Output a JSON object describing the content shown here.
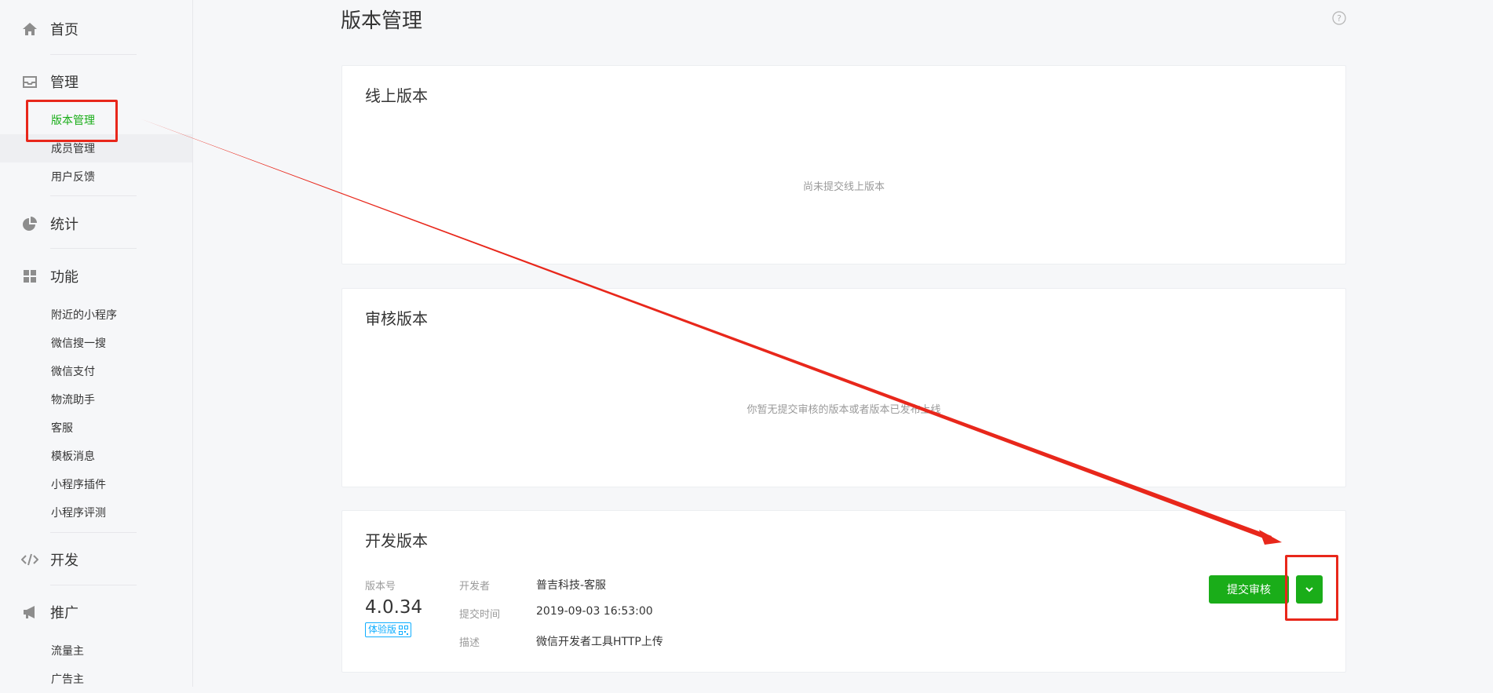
{
  "sidebar": {
    "home": "首页",
    "manage": {
      "title": "管理",
      "items": [
        "版本管理",
        "成员管理",
        "用户反馈"
      ]
    },
    "stats": "统计",
    "features": {
      "title": "功能",
      "items": [
        "附近的小程序",
        "微信搜一搜",
        "微信支付",
        "物流助手",
        "客服",
        "模板消息",
        "小程序插件",
        "小程序评测"
      ]
    },
    "dev": "开发",
    "promo": {
      "title": "推广",
      "items": [
        "流量主",
        "广告主"
      ]
    }
  },
  "main": {
    "title": "版本管理",
    "online": {
      "title": "线上版本",
      "empty": "尚未提交线上版本"
    },
    "review": {
      "title": "审核版本",
      "empty": "你暂无提交审核的版本或者版本已发布上线"
    },
    "dev": {
      "title": "开发版本",
      "version_label": "版本号",
      "version": "4.0.34",
      "tag": "体验版",
      "developer_key": "开发者",
      "developer": "普吉科技-客服",
      "time_key": "提交时间",
      "time": "2019-09-03 16:53:00",
      "desc_key": "描述",
      "desc": "微信开发者工具HTTP上传",
      "submit_label": "提交审核"
    }
  },
  "colors": {
    "accent": "#1aad19",
    "annotation": "#e8271b",
    "tag": "#10aeff"
  }
}
